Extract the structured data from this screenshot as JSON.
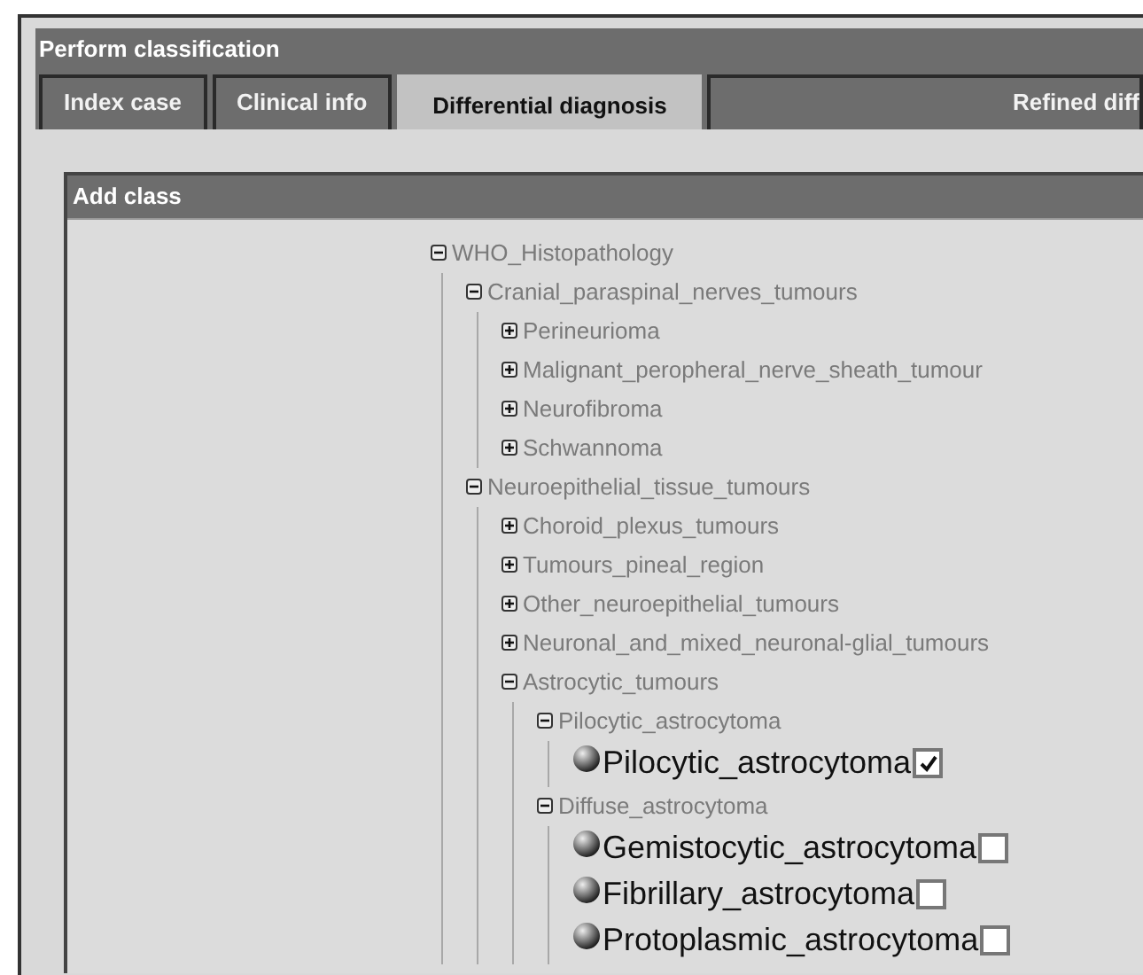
{
  "window": {
    "title": "Perform classification"
  },
  "tabs": [
    {
      "label": "Index case",
      "selected": false
    },
    {
      "label": "Clinical info",
      "selected": false
    },
    {
      "label": "Differential diagnosis",
      "selected": true
    },
    {
      "label": "Refined diff",
      "selected": false
    }
  ],
  "panel": {
    "title": "Add class"
  },
  "tree": [
    {
      "label": "WHO_Histopathology",
      "kind": "folder",
      "expanded": true,
      "children": [
        {
          "label": "Cranial_paraspinal_nerves_tumours",
          "kind": "folder",
          "expanded": true,
          "children": [
            {
              "label": "Perineurioma",
              "kind": "folder",
              "expanded": false
            },
            {
              "label": "Malignant_peropheral_nerve_sheath_tumour",
              "kind": "folder",
              "expanded": false
            },
            {
              "label": "Neurofibroma",
              "kind": "folder",
              "expanded": false
            },
            {
              "label": "Schwannoma",
              "kind": "folder",
              "expanded": false
            }
          ]
        },
        {
          "label": "Neuroepithelial_tissue_tumours",
          "kind": "folder",
          "expanded": true,
          "children": [
            {
              "label": "Choroid_plexus_tumours",
              "kind": "folder",
              "expanded": false
            },
            {
              "label": "Tumours_pineal_region",
              "kind": "folder",
              "expanded": false
            },
            {
              "label": "Other_neuroepithelial_tumours",
              "kind": "folder",
              "expanded": false
            },
            {
              "label": "Neuronal_and_mixed_neuronal-glial_tumours",
              "kind": "folder",
              "expanded": false
            },
            {
              "label": "Astrocytic_tumours",
              "kind": "folder",
              "expanded": true,
              "children": [
                {
                  "label": "Pilocytic_astrocytoma",
                  "kind": "folder",
                  "expanded": true,
                  "children": [
                    {
                      "label": "Pilocytic_astrocytoma",
                      "kind": "leaf",
                      "checked": true
                    }
                  ]
                },
                {
                  "label": "Diffuse_astrocytoma",
                  "kind": "folder",
                  "expanded": true,
                  "children": [
                    {
                      "label": "Gemistocytic_astrocytoma",
                      "kind": "leaf",
                      "checked": false
                    },
                    {
                      "label": "Fibrillary_astrocytoma",
                      "kind": "leaf",
                      "checked": false
                    },
                    {
                      "label": "Protoplasmic_astrocytoma",
                      "kind": "leaf",
                      "checked": false
                    }
                  ]
                }
              ]
            }
          ]
        }
      ]
    }
  ]
}
